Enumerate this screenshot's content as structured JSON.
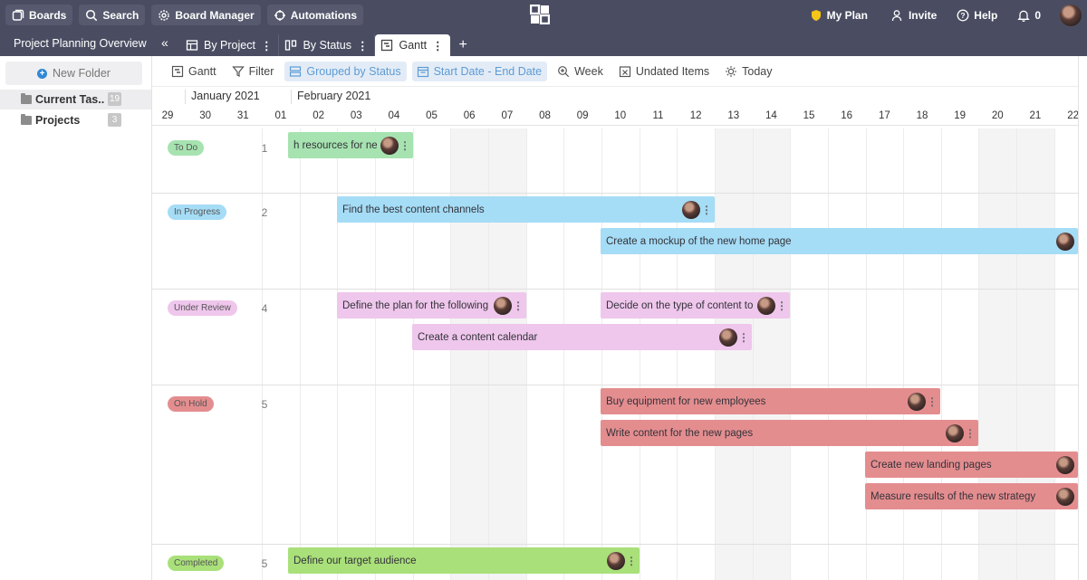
{
  "topnav": {
    "boards": "Boards",
    "search": "Search",
    "board_manager": "Board Manager",
    "automations": "Automations",
    "my_plan": "My Plan",
    "invite": "Invite",
    "help": "Help",
    "notifications": "0"
  },
  "subbar": {
    "project_title": "Project Planning Overview",
    "tabs": [
      {
        "label": "By Project",
        "icon": "table-icon"
      },
      {
        "label": "By Status",
        "icon": "kanban-icon"
      },
      {
        "label": "Gantt",
        "icon": "gantt-icon"
      }
    ]
  },
  "sidebar": {
    "new_folder": "New Folder",
    "folders": [
      {
        "label": "Current Tas...",
        "count": "19"
      },
      {
        "label": "Projects",
        "count": "3"
      }
    ]
  },
  "toolbar": {
    "gantt": "Gantt",
    "filter": "Filter",
    "grouped": "Grouped by Status",
    "dates": "Start Date - End Date",
    "week": "Week",
    "undated": "Undated Items",
    "today": "Today"
  },
  "timeline": {
    "months": [
      "January 2021",
      "February 2021"
    ],
    "days": [
      "29",
      "30",
      "31",
      "01",
      "02",
      "03",
      "04",
      "05",
      "06",
      "07",
      "08",
      "09",
      "10",
      "11",
      "12",
      "13",
      "14",
      "15",
      "16",
      "17",
      "18",
      "19",
      "20",
      "21",
      "22"
    ]
  },
  "groups": [
    {
      "status": "To Do",
      "count": "1",
      "color": "#a6e3b0"
    },
    {
      "status": "In Progress",
      "count": "2",
      "color": "#a5dcf6"
    },
    {
      "status": "Under Review",
      "count": "4",
      "color": "#efc6ec"
    },
    {
      "status": "On Hold",
      "count": "5",
      "color": "#e48d8f"
    },
    {
      "status": "Completed",
      "count": "5",
      "color": "#a9e07a"
    }
  ],
  "tasks": [
    {
      "name": "h resources for new",
      "group": "To Do"
    },
    {
      "name": "Find the best content channels",
      "group": "In Progress"
    },
    {
      "name": "Create a mockup of the new home page",
      "group": "In Progress"
    },
    {
      "name": "Define the plan for the following m",
      "group": "Under Review"
    },
    {
      "name": "Decide on the type of content to u",
      "group": "Under Review"
    },
    {
      "name": "Create a content calendar",
      "group": "Under Review"
    },
    {
      "name": "Buy equipment for new employees",
      "group": "On Hold"
    },
    {
      "name": "Write content for the new pages",
      "group": "On Hold"
    },
    {
      "name": "Create new landing pages",
      "group": "On Hold"
    },
    {
      "name": "Measure results of the new strategy",
      "group": "On Hold"
    },
    {
      "name": "Define our target audience",
      "group": "Completed"
    }
  ]
}
